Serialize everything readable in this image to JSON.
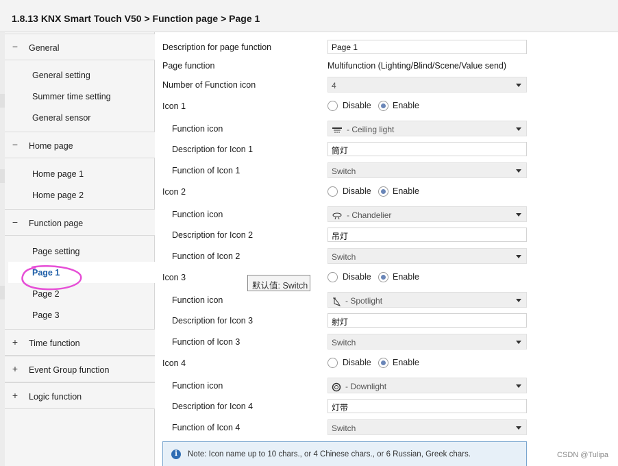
{
  "title": "1.8.13 KNX Smart Touch V50 > Function page  > Page 1",
  "sidebar": {
    "groups": [
      {
        "symbol": "−",
        "label": "General"
      },
      {
        "symbol": "−",
        "label": "Home page"
      },
      {
        "symbol": "−",
        "label": "Function page"
      },
      {
        "symbol": "+",
        "label": "Time function"
      },
      {
        "symbol": "+",
        "label": "Event Group function"
      },
      {
        "symbol": "+",
        "label": "Logic function"
      }
    ],
    "items": {
      "general_setting": "General setting",
      "summer_time_setting": "Summer time setting",
      "general_sensor": "General sensor",
      "home_page_1": "Home page 1",
      "home_page_2": "Home page 2",
      "page_setting": "Page setting",
      "page_1": "Page 1",
      "page_2": "Page 2",
      "page_3": "Page 3"
    }
  },
  "form": {
    "description_label": "Description for page function",
    "description_value": "Page 1",
    "page_function_label": "Page function",
    "page_function_value": "Multifunction (Lighting/Blind/Scene/Value send)",
    "number_icon_label": "Number of  Function icon",
    "number_icon_value": "4",
    "disable_label": "Disable",
    "enable_label": "Enable",
    "function_icon_label": "Function icon",
    "icons": [
      {
        "label": "Icon 1",
        "icon_value": "- Ceiling light",
        "icon_glyph": "ceiling-light-icon",
        "desc_label": "Description for Icon 1",
        "desc_value": "筒灯",
        "func_label": "Function of Icon 1",
        "func_value": "Switch",
        "enabled": true
      },
      {
        "label": "Icon 2",
        "icon_value": "- Chandelier",
        "icon_glyph": "chandelier-icon",
        "desc_label": "Description for Icon 2",
        "desc_value": "吊灯",
        "func_label": "Function of Icon 2",
        "func_value": "Switch",
        "enabled": true
      },
      {
        "label": "Icon 3",
        "icon_value": "- Spotlight",
        "icon_glyph": "spotlight-icon",
        "desc_label": "Description for Icon 3",
        "desc_value": "射灯",
        "func_label": "Function of Icon 3",
        "func_value": "Switch",
        "enabled": true
      },
      {
        "label": "Icon 4",
        "icon_value": "- Downlight",
        "icon_glyph": "downlight-icon",
        "desc_label": "Description for Icon 4",
        "desc_value": "灯带",
        "func_label": "Function of Icon 4",
        "func_value": "Switch",
        "enabled": true
      }
    ]
  },
  "tooltip": "默认值: Switch",
  "note": "Note: Icon name up to 10 chars., or 4 Chinese chars., or 6 Russian, Greek chars.",
  "watermark": "CSDN @Tulipa",
  "colors": {
    "active_item": "#1f5fa8",
    "highlight_ring": "#e64fd6",
    "note_border": "#7aa6cf"
  }
}
